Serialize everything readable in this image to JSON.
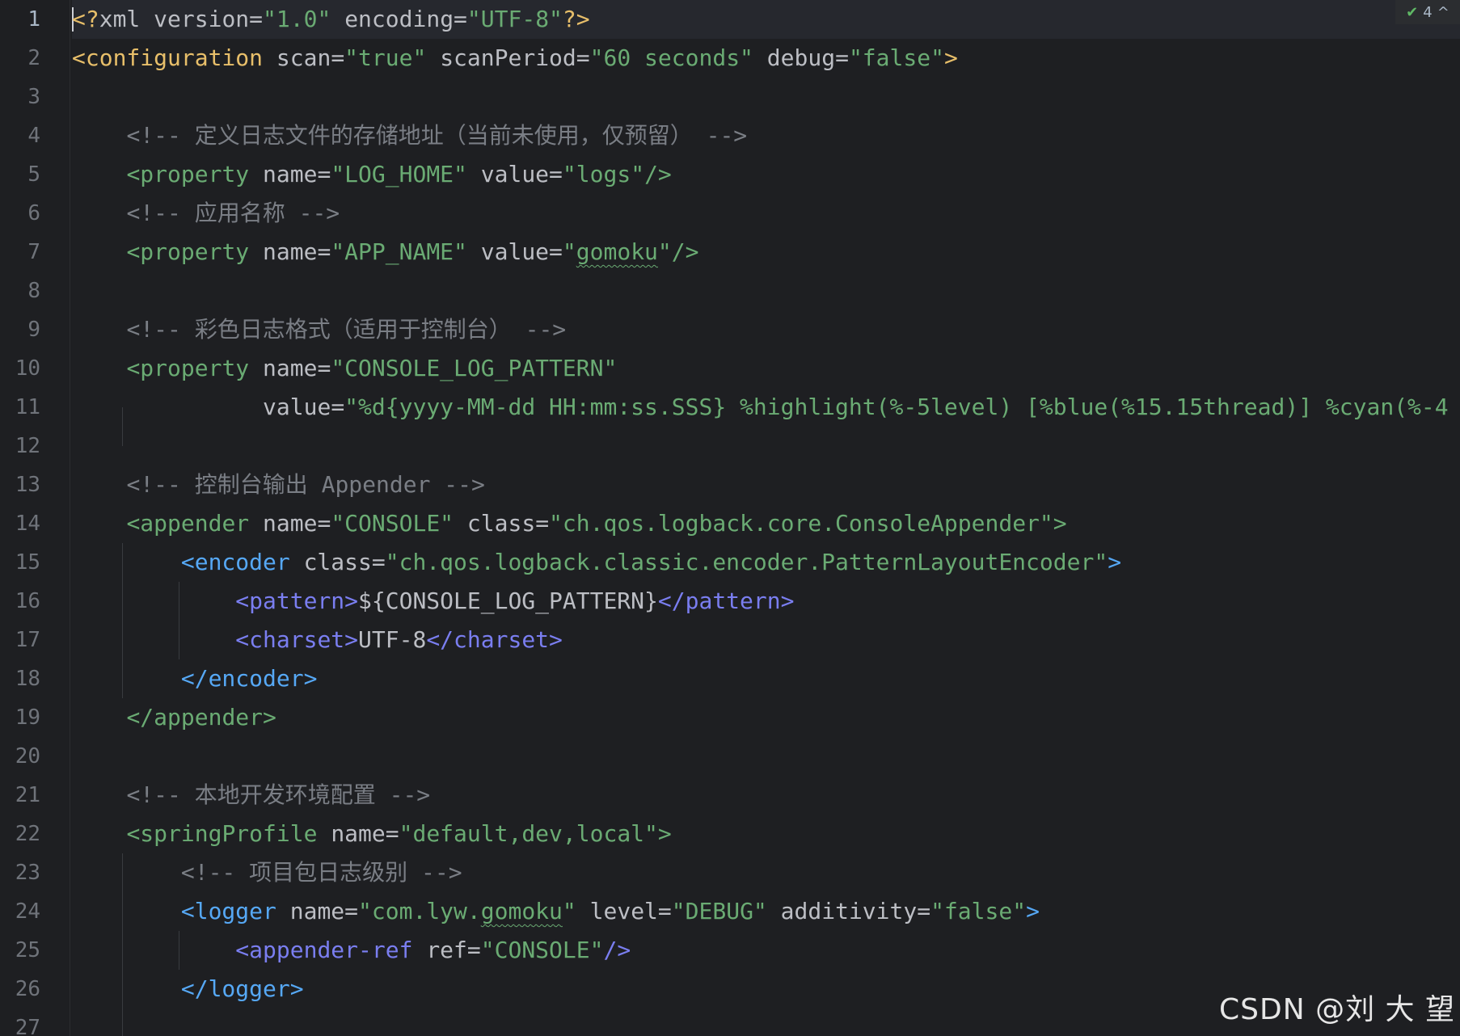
{
  "colors": {
    "background": "#1e1f22",
    "tag_yellow": "#e8bf6a",
    "tag_green": "#6aab73",
    "tag_blue": "#56a8f5",
    "tag_purple": "#7a7ef0",
    "string": "#6aab73",
    "comment": "#7a7e85",
    "default_text": "#bcbec4"
  },
  "inspection": {
    "icon": "check-double-icon",
    "count": "4",
    "chevron": "^"
  },
  "watermark": "CSDN @刘 大 望",
  "lines": [
    {
      "num": "1",
      "tokens": [
        {
          "t": "<?",
          "c": "t-punc"
        },
        {
          "t": "xml ",
          "c": "t-attr"
        },
        {
          "t": "version",
          "c": "t-attr"
        },
        {
          "t": "=",
          "c": "t-eq"
        },
        {
          "t": "\"1.0\"",
          "c": "t-val"
        },
        {
          "t": " ",
          "c": "t-text"
        },
        {
          "t": "encoding",
          "c": "t-attr"
        },
        {
          "t": "=",
          "c": "t-eq"
        },
        {
          "t": "\"UTF-8\"",
          "c": "t-val"
        },
        {
          "t": "?>",
          "c": "t-punc"
        }
      ]
    },
    {
      "num": "2",
      "tokens": [
        {
          "t": "<configuration",
          "c": "t-tagY"
        },
        {
          "t": " ",
          "c": "t-text"
        },
        {
          "t": "scan",
          "c": "t-attr"
        },
        {
          "t": "=",
          "c": "t-eq"
        },
        {
          "t": "\"true\"",
          "c": "t-val"
        },
        {
          "t": " ",
          "c": "t-text"
        },
        {
          "t": "scanPeriod",
          "c": "t-attr"
        },
        {
          "t": "=",
          "c": "t-eq"
        },
        {
          "t": "\"60 seconds\"",
          "c": "t-val"
        },
        {
          "t": " ",
          "c": "t-text"
        },
        {
          "t": "debug",
          "c": "t-attr"
        },
        {
          "t": "=",
          "c": "t-eq"
        },
        {
          "t": "\"false\"",
          "c": "t-val"
        },
        {
          "t": ">",
          "c": "t-tagY"
        }
      ]
    },
    {
      "num": "3",
      "tokens": []
    },
    {
      "num": "4",
      "tokens": [
        {
          "t": "    ",
          "c": "t-text"
        },
        {
          "t": "<!-- 定义日志文件的存储地址（当前未使用，仅预留） -->",
          "c": "t-com"
        }
      ]
    },
    {
      "num": "5",
      "tokens": [
        {
          "t": "    ",
          "c": "t-text"
        },
        {
          "t": "<property",
          "c": "t-tagG"
        },
        {
          "t": " ",
          "c": "t-text"
        },
        {
          "t": "name",
          "c": "t-attr"
        },
        {
          "t": "=",
          "c": "t-eq"
        },
        {
          "t": "\"LOG_HOME\"",
          "c": "t-val"
        },
        {
          "t": " ",
          "c": "t-text"
        },
        {
          "t": "value",
          "c": "t-attr"
        },
        {
          "t": "=",
          "c": "t-eq"
        },
        {
          "t": "\"logs\"",
          "c": "t-val"
        },
        {
          "t": "/>",
          "c": "t-tagG"
        }
      ]
    },
    {
      "num": "6",
      "tokens": [
        {
          "t": "    ",
          "c": "t-text"
        },
        {
          "t": "<!-- 应用名称 -->",
          "c": "t-com"
        }
      ]
    },
    {
      "num": "7",
      "tokens": [
        {
          "t": "    ",
          "c": "t-text"
        },
        {
          "t": "<property",
          "c": "t-tagG"
        },
        {
          "t": " ",
          "c": "t-text"
        },
        {
          "t": "name",
          "c": "t-attr"
        },
        {
          "t": "=",
          "c": "t-eq"
        },
        {
          "t": "\"APP_NAME\"",
          "c": "t-val"
        },
        {
          "t": " ",
          "c": "t-text"
        },
        {
          "t": "value",
          "c": "t-attr"
        },
        {
          "t": "=",
          "c": "t-eq"
        },
        {
          "t": "\"",
          "c": "t-val"
        },
        {
          "t": "gomoku",
          "c": "t-val squig"
        },
        {
          "t": "\"",
          "c": "t-val"
        },
        {
          "t": "/>",
          "c": "t-tagG"
        }
      ]
    },
    {
      "num": "8",
      "tokens": []
    },
    {
      "num": "9",
      "tokens": [
        {
          "t": "    ",
          "c": "t-text"
        },
        {
          "t": "<!-- 彩色日志格式（适用于控制台） -->",
          "c": "t-com"
        }
      ]
    },
    {
      "num": "10",
      "tokens": [
        {
          "t": "    ",
          "c": "t-text"
        },
        {
          "t": "<property",
          "c": "t-tagG"
        },
        {
          "t": " ",
          "c": "t-text"
        },
        {
          "t": "name",
          "c": "t-attr"
        },
        {
          "t": "=",
          "c": "t-eq"
        },
        {
          "t": "\"CONSOLE_LOG_PATTERN\"",
          "c": "t-val"
        }
      ]
    },
    {
      "num": "11",
      "tokens": [
        {
          "t": "              ",
          "c": "t-text"
        },
        {
          "t": "value",
          "c": "t-attr"
        },
        {
          "t": "=",
          "c": "t-eq"
        },
        {
          "t": "\"%d{yyyy-MM-dd HH:mm:ss.SSS} %highlight(%-5level) [%blue(%15.15thread)] %cyan(%-4",
          "c": "t-val"
        }
      ]
    },
    {
      "num": "12",
      "tokens": []
    },
    {
      "num": "13",
      "tokens": [
        {
          "t": "    ",
          "c": "t-text"
        },
        {
          "t": "<!-- 控制台输出 Appender -->",
          "c": "t-com"
        }
      ]
    },
    {
      "num": "14",
      "tokens": [
        {
          "t": "    ",
          "c": "t-text"
        },
        {
          "t": "<appender",
          "c": "t-tagG"
        },
        {
          "t": " ",
          "c": "t-text"
        },
        {
          "t": "name",
          "c": "t-attr"
        },
        {
          "t": "=",
          "c": "t-eq"
        },
        {
          "t": "\"CONSOLE\"",
          "c": "t-val"
        },
        {
          "t": " ",
          "c": "t-text"
        },
        {
          "t": "class",
          "c": "t-attr"
        },
        {
          "t": "=",
          "c": "t-eq"
        },
        {
          "t": "\"ch.qos.logback.core.ConsoleAppender\"",
          "c": "t-val"
        },
        {
          "t": ">",
          "c": "t-tagG"
        }
      ]
    },
    {
      "num": "15",
      "tokens": [
        {
          "t": "        ",
          "c": "t-text"
        },
        {
          "t": "<encoder",
          "c": "t-tagB"
        },
        {
          "t": " ",
          "c": "t-text"
        },
        {
          "t": "class",
          "c": "t-attr"
        },
        {
          "t": "=",
          "c": "t-eq"
        },
        {
          "t": "\"ch.qos.logback.classic.encoder.PatternLayoutEncoder\"",
          "c": "t-val"
        },
        {
          "t": ">",
          "c": "t-tagB"
        }
      ]
    },
    {
      "num": "16",
      "tokens": [
        {
          "t": "            ",
          "c": "t-text"
        },
        {
          "t": "<pattern>",
          "c": "t-tagP"
        },
        {
          "t": "${CONSOLE_LOG_PATTERN}",
          "c": "t-text"
        },
        {
          "t": "</pattern>",
          "c": "t-tagP"
        }
      ]
    },
    {
      "num": "17",
      "tokens": [
        {
          "t": "            ",
          "c": "t-text"
        },
        {
          "t": "<charset>",
          "c": "t-tagP"
        },
        {
          "t": "UTF-8",
          "c": "t-text"
        },
        {
          "t": "</charset>",
          "c": "t-tagP"
        }
      ]
    },
    {
      "num": "18",
      "tokens": [
        {
          "t": "        ",
          "c": "t-text"
        },
        {
          "t": "</encoder>",
          "c": "t-tagB"
        }
      ]
    },
    {
      "num": "19",
      "tokens": [
        {
          "t": "    ",
          "c": "t-text"
        },
        {
          "t": "</appender>",
          "c": "t-tagG"
        }
      ]
    },
    {
      "num": "20",
      "tokens": []
    },
    {
      "num": "21",
      "tokens": [
        {
          "t": "    ",
          "c": "t-text"
        },
        {
          "t": "<!-- 本地开发环境配置 -->",
          "c": "t-com"
        }
      ]
    },
    {
      "num": "22",
      "tokens": [
        {
          "t": "    ",
          "c": "t-text"
        },
        {
          "t": "<springProfile",
          "c": "t-tagG"
        },
        {
          "t": " ",
          "c": "t-text"
        },
        {
          "t": "name",
          "c": "t-attr"
        },
        {
          "t": "=",
          "c": "t-eq"
        },
        {
          "t": "\"default,dev,local\"",
          "c": "t-val"
        },
        {
          "t": ">",
          "c": "t-tagG"
        }
      ]
    },
    {
      "num": "23",
      "tokens": [
        {
          "t": "        ",
          "c": "t-text"
        },
        {
          "t": "<!-- 项目包日志级别 -->",
          "c": "t-com"
        }
      ]
    },
    {
      "num": "24",
      "tokens": [
        {
          "t": "        ",
          "c": "t-text"
        },
        {
          "t": "<logger",
          "c": "t-tagB"
        },
        {
          "t": " ",
          "c": "t-text"
        },
        {
          "t": "name",
          "c": "t-attr"
        },
        {
          "t": "=",
          "c": "t-eq"
        },
        {
          "t": "\"com.lyw.",
          "c": "t-val"
        },
        {
          "t": "gomoku",
          "c": "t-val squig"
        },
        {
          "t": "\"",
          "c": "t-val"
        },
        {
          "t": " ",
          "c": "t-text"
        },
        {
          "t": "level",
          "c": "t-attr"
        },
        {
          "t": "=",
          "c": "t-eq"
        },
        {
          "t": "\"DEBUG\"",
          "c": "t-val"
        },
        {
          "t": " ",
          "c": "t-text"
        },
        {
          "t": "additivity",
          "c": "t-attr"
        },
        {
          "t": "=",
          "c": "t-eq"
        },
        {
          "t": "\"false\"",
          "c": "t-val"
        },
        {
          "t": ">",
          "c": "t-tagB"
        }
      ]
    },
    {
      "num": "25",
      "tokens": [
        {
          "t": "            ",
          "c": "t-text"
        },
        {
          "t": "<appender-ref",
          "c": "t-tagP"
        },
        {
          "t": " ",
          "c": "t-text"
        },
        {
          "t": "ref",
          "c": "t-attr"
        },
        {
          "t": "=",
          "c": "t-eq"
        },
        {
          "t": "\"CONSOLE\"",
          "c": "t-val"
        },
        {
          "t": "/>",
          "c": "t-tagP"
        }
      ]
    },
    {
      "num": "26",
      "tokens": [
        {
          "t": "        ",
          "c": "t-text"
        },
        {
          "t": "</logger>",
          "c": "t-tagB"
        }
      ]
    },
    {
      "num": "27",
      "tokens": []
    }
  ]
}
